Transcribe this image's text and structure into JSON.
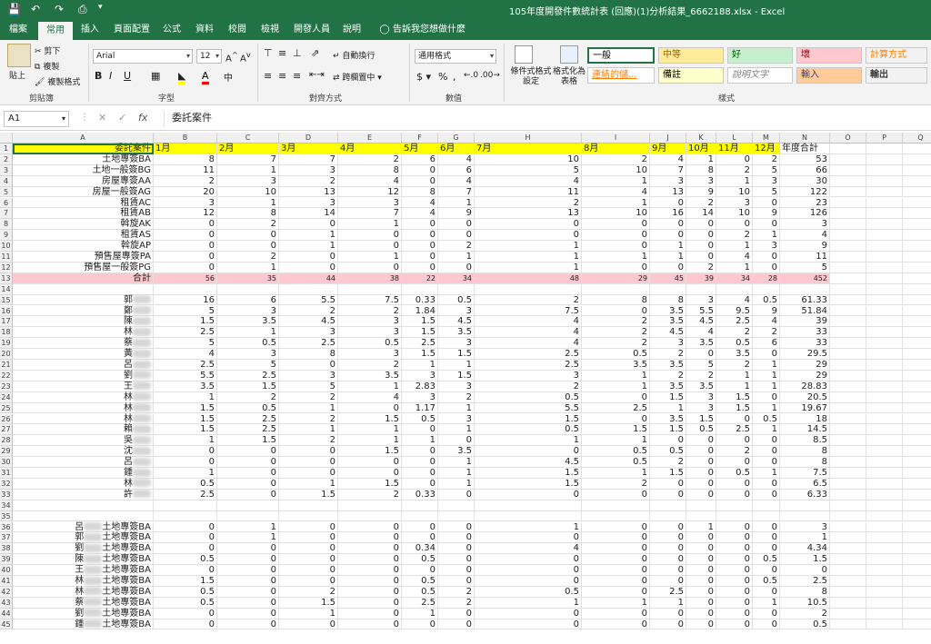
{
  "window": {
    "title": "105年度開發件數統計表 (回應)(1)分析結果_6662188.xlsx - Excel"
  },
  "tabs": [
    "檔案",
    "常用",
    "插入",
    "頁面配置",
    "公式",
    "資料",
    "校閱",
    "檢視",
    "開發人員",
    "說明"
  ],
  "tell_me": "告訴我您想做什麼",
  "ribbon": {
    "clipboard": {
      "paste": "貼上",
      "cut": "剪下",
      "copy": "複製",
      "format_painter": "複製格式",
      "label": "剪貼簿"
    },
    "font": {
      "name": "Arial",
      "size": "12",
      "label": "字型"
    },
    "alignment": {
      "wrap": "自動換行",
      "merge": "跨欄置中",
      "label": "對齊方式"
    },
    "number": {
      "format": "通用格式",
      "label": "數值"
    },
    "conditional": {
      "cf": "條件式格式設定",
      "table": "格式化為表格"
    },
    "styles": {
      "label": "樣式",
      "items": [
        {
          "text": "一般",
          "bg": "#ffffff",
          "fg": "#000000"
        },
        {
          "text": "中等",
          "bg": "#ffeb9c",
          "fg": "#9c6500"
        },
        {
          "text": "好",
          "bg": "#c6efce",
          "fg": "#006100"
        },
        {
          "text": "壞",
          "bg": "#ffc7ce",
          "fg": "#9c0006"
        },
        {
          "text": "計算方式",
          "bg": "#f2f2f2",
          "fg": "#fa7d00"
        },
        {
          "text": "連結的儲...",
          "bg": "#ffffff",
          "fg": "#fa7d00"
        },
        {
          "text": "備註",
          "bg": "#ffffcc",
          "fg": "#000000"
        },
        {
          "text": "說明文字",
          "bg": "#ffffff",
          "fg": "#7f7f7f"
        },
        {
          "text": "輸入",
          "bg": "#ffcc99",
          "fg": "#3f3f76"
        },
        {
          "text": "輸出",
          "bg": "#f2f2f2",
          "fg": "#3f3f3f"
        }
      ]
    }
  },
  "formula_bar": {
    "cell": "A1",
    "content": "委託案件"
  },
  "columns": [
    "A",
    "B",
    "C",
    "D",
    "E",
    "F",
    "G",
    "H",
    "I",
    "J",
    "K",
    "L",
    "M",
    "N",
    "O",
    "P",
    "Q"
  ],
  "header_row": [
    "委託案件",
    "1月",
    "2月",
    "3月",
    "4月",
    "5月",
    "6月",
    "7月",
    "8月",
    "9月",
    "10月",
    "11月",
    "12月",
    "年度合計"
  ],
  "rows": [
    {
      "r": 2,
      "a": "土地專簽BA",
      "v": [
        "8",
        "7",
        "7",
        "2",
        "6",
        "4",
        "10",
        "2",
        "4",
        "1",
        "0",
        "2",
        "53"
      ]
    },
    {
      "r": 3,
      "a": "土地一般簽BG",
      "v": [
        "11",
        "1",
        "3",
        "8",
        "0",
        "6",
        "5",
        "10",
        "7",
        "8",
        "2",
        "5",
        "66"
      ]
    },
    {
      "r": 4,
      "a": "房屋專簽AA",
      "v": [
        "2",
        "3",
        "2",
        "4",
        "0",
        "4",
        "4",
        "1",
        "3",
        "3",
        "1",
        "3",
        "30"
      ]
    },
    {
      "r": 5,
      "a": "房屋一般簽AG",
      "v": [
        "20",
        "10",
        "13",
        "12",
        "8",
        "7",
        "11",
        "4",
        "13",
        "9",
        "10",
        "5",
        "122"
      ]
    },
    {
      "r": 6,
      "a": "租賃AC",
      "v": [
        "3",
        "1",
        "3",
        "3",
        "4",
        "1",
        "2",
        "1",
        "0",
        "2",
        "3",
        "0",
        "23"
      ]
    },
    {
      "r": 7,
      "a": "租賃AB",
      "v": [
        "12",
        "8",
        "14",
        "7",
        "4",
        "9",
        "13",
        "10",
        "16",
        "14",
        "10",
        "9",
        "126"
      ]
    },
    {
      "r": 8,
      "a": "斡旋AK",
      "v": [
        "0",
        "2",
        "0",
        "1",
        "0",
        "0",
        "0",
        "0",
        "0",
        "0",
        "0",
        "0",
        "3"
      ]
    },
    {
      "r": 9,
      "a": "租賃AS",
      "v": [
        "0",
        "0",
        "1",
        "0",
        "0",
        "0",
        "0",
        "0",
        "0",
        "0",
        "2",
        "1",
        "4"
      ]
    },
    {
      "r": 10,
      "a": "斡旋AP",
      "v": [
        "0",
        "0",
        "1",
        "0",
        "0",
        "2",
        "1",
        "0",
        "1",
        "0",
        "1",
        "3",
        "9"
      ]
    },
    {
      "r": 11,
      "a": "預售屋專簽PA",
      "v": [
        "0",
        "2",
        "0",
        "1",
        "0",
        "1",
        "1",
        "1",
        "1",
        "0",
        "4",
        "0",
        "11"
      ]
    },
    {
      "r": 12,
      "a": "預售屋一般簽PG",
      "v": [
        "0",
        "1",
        "0",
        "0",
        "0",
        "0",
        "1",
        "0",
        "0",
        "2",
        "1",
        "0",
        "5"
      ]
    },
    {
      "r": 13,
      "a": "合計",
      "v": [
        "56",
        "35",
        "44",
        "38",
        "22",
        "34",
        "48",
        "29",
        "45",
        "39",
        "34",
        "28",
        "452"
      ],
      "pink": true
    },
    {
      "r": 14,
      "a": "",
      "v": []
    },
    {
      "r": 15,
      "a": "郭",
      "blur": true,
      "v": [
        "16",
        "6",
        "5.5",
        "7.5",
        "0.33",
        "0.5",
        "2",
        "8",
        "8",
        "3",
        "4",
        "0.5",
        "61.33"
      ]
    },
    {
      "r": 16,
      "a": "鄭",
      "blur": true,
      "v": [
        "5",
        "3",
        "2",
        "2",
        "1.84",
        "3",
        "7.5",
        "0",
        "3.5",
        "5.5",
        "9.5",
        "9",
        "51.84"
      ]
    },
    {
      "r": 17,
      "a": "陳",
      "blur": true,
      "v": [
        "1.5",
        "3.5",
        "4.5",
        "3",
        "1.5",
        "4.5",
        "4",
        "2",
        "3.5",
        "4.5",
        "2.5",
        "4",
        "39"
      ]
    },
    {
      "r": 18,
      "a": "林",
      "blur": true,
      "v": [
        "2.5",
        "1",
        "3",
        "3",
        "1.5",
        "3.5",
        "4",
        "2",
        "4.5",
        "4",
        "2",
        "2",
        "33"
      ]
    },
    {
      "r": 19,
      "a": "蔡",
      "blur": true,
      "v": [
        "5",
        "0.5",
        "2.5",
        "0.5",
        "2.5",
        "3",
        "4",
        "2",
        "3",
        "3.5",
        "0.5",
        "6",
        "33"
      ]
    },
    {
      "r": 20,
      "a": "黃",
      "blur": true,
      "v": [
        "4",
        "3",
        "8",
        "3",
        "1.5",
        "1.5",
        "2.5",
        "0.5",
        "2",
        "0",
        "3.5",
        "0",
        "29.5"
      ]
    },
    {
      "r": 21,
      "a": "呂",
      "blur": true,
      "v": [
        "2.5",
        "5",
        "0",
        "2",
        "1",
        "1",
        "2.5",
        "3.5",
        "3.5",
        "5",
        "2",
        "1",
        "29"
      ]
    },
    {
      "r": 22,
      "a": "劉",
      "blur": true,
      "v": [
        "5.5",
        "2.5",
        "3",
        "3.5",
        "3",
        "1.5",
        "3",
        "1",
        "2",
        "2",
        "1",
        "1",
        "29"
      ]
    },
    {
      "r": 23,
      "a": "王",
      "blur": true,
      "v": [
        "3.5",
        "1.5",
        "5",
        "1",
        "2.83",
        "3",
        "2",
        "1",
        "3.5",
        "3.5",
        "1",
        "1",
        "28.83"
      ]
    },
    {
      "r": 24,
      "a": "林",
      "blur": true,
      "v": [
        "1",
        "2",
        "2",
        "4",
        "3",
        "2",
        "0.5",
        "0",
        "1.5",
        "3",
        "1.5",
        "0",
        "20.5"
      ]
    },
    {
      "r": 25,
      "a": "林",
      "blur": true,
      "v": [
        "1.5",
        "0.5",
        "1",
        "0",
        "1.17",
        "1",
        "5.5",
        "2.5",
        "1",
        "3",
        "1.5",
        "1",
        "19.67"
      ]
    },
    {
      "r": 26,
      "a": "林",
      "blur": true,
      "v": [
        "1.5",
        "2.5",
        "2",
        "1.5",
        "0.5",
        "3",
        "1.5",
        "0",
        "3.5",
        "1.5",
        "0",
        "0.5",
        "18"
      ]
    },
    {
      "r": 27,
      "a": "賴",
      "blur": true,
      "v": [
        "1.5",
        "2.5",
        "1",
        "1",
        "0",
        "1",
        "0.5",
        "1.5",
        "1.5",
        "0.5",
        "2.5",
        "1",
        "14.5"
      ]
    },
    {
      "r": 28,
      "a": "吳",
      "blur": true,
      "v": [
        "1",
        "1.5",
        "2",
        "1",
        "1",
        "0",
        "1",
        "1",
        "0",
        "0",
        "0",
        "0",
        "8.5"
      ]
    },
    {
      "r": 29,
      "a": "沈",
      "blur": true,
      "v": [
        "0",
        "0",
        "0",
        "1.5",
        "0",
        "3.5",
        "0",
        "0.5",
        "0.5",
        "0",
        "2",
        "0",
        "8"
      ]
    },
    {
      "r": 30,
      "a": "呂",
      "blur": true,
      "v": [
        "0",
        "0",
        "0",
        "0",
        "0",
        "1",
        "4.5",
        "0.5",
        "2",
        "0",
        "0",
        "0",
        "8"
      ]
    },
    {
      "r": 31,
      "a": "鍾",
      "blur": true,
      "v": [
        "1",
        "0",
        "0",
        "0",
        "0",
        "1",
        "1.5",
        "1",
        "1.5",
        "0",
        "0.5",
        "1",
        "7.5"
      ]
    },
    {
      "r": 32,
      "a": "林",
      "blur": true,
      "v": [
        "0.5",
        "0",
        "1",
        "1.5",
        "0",
        "1",
        "1.5",
        "2",
        "0",
        "0",
        "0",
        "0",
        "6.5"
      ]
    },
    {
      "r": 33,
      "a": "許",
      "blur": true,
      "v": [
        "2.5",
        "0",
        "1.5",
        "2",
        "0.33",
        "0",
        "0",
        "0",
        "0",
        "0",
        "0",
        "0",
        "6.33"
      ]
    },
    {
      "r": 34,
      "a": "",
      "v": []
    },
    {
      "r": 35,
      "a": "",
      "v": []
    },
    {
      "r": 36,
      "a": "呂",
      "suffix": "土地專簽BA",
      "blur": true,
      "v": [
        "0",
        "1",
        "0",
        "0",
        "0",
        "0",
        "1",
        "0",
        "0",
        "1",
        "0",
        "0",
        "3"
      ]
    },
    {
      "r": 37,
      "a": "郭",
      "suffix": "土地專簽BA",
      "blur": true,
      "v": [
        "0",
        "1",
        "0",
        "0",
        "0",
        "0",
        "0",
        "0",
        "0",
        "0",
        "0",
        "0",
        "1"
      ]
    },
    {
      "r": 38,
      "a": "劉",
      "suffix": "土地專簽BA",
      "blur": true,
      "v": [
        "0",
        "0",
        "0",
        "0",
        "0.34",
        "0",
        "4",
        "0",
        "0",
        "0",
        "0",
        "0",
        "4.34"
      ]
    },
    {
      "r": 39,
      "a": "陳",
      "suffix": "土地專簽BA",
      "blur": true,
      "v": [
        "0.5",
        "0",
        "0",
        "0",
        "0.5",
        "0",
        "0",
        "0",
        "0",
        "0",
        "0",
        "0.5",
        "1.5"
      ]
    },
    {
      "r": 40,
      "a": "王",
      "suffix": "土地專簽BA",
      "blur": true,
      "v": [
        "0",
        "0",
        "0",
        "0",
        "0",
        "0",
        "0",
        "0",
        "0",
        "0",
        "0",
        "0",
        "0"
      ]
    },
    {
      "r": 41,
      "a": "林",
      "suffix": "土地專簽BA",
      "blur": true,
      "v": [
        "1.5",
        "0",
        "0",
        "0",
        "0.5",
        "0",
        "0",
        "0",
        "0",
        "0",
        "0",
        "0.5",
        "2.5"
      ]
    },
    {
      "r": 42,
      "a": "林",
      "suffix": "土地專簽BA",
      "blur": true,
      "v": [
        "0.5",
        "0",
        "2",
        "0",
        "0.5",
        "2",
        "0.5",
        "0",
        "2.5",
        "0",
        "0",
        "0",
        "8"
      ]
    },
    {
      "r": 43,
      "a": "蔡",
      "suffix": "土地專簽BA",
      "blur": true,
      "v": [
        "0.5",
        "0",
        "1.5",
        "0",
        "2.5",
        "2",
        "1",
        "1",
        "1",
        "0",
        "0",
        "1",
        "10.5"
      ]
    },
    {
      "r": 44,
      "a": "劉",
      "suffix": "土地專簽BA",
      "blur": true,
      "v": [
        "0",
        "0",
        "1",
        "0",
        "1",
        "0",
        "0",
        "0",
        "0",
        "0",
        "0",
        "0",
        "2"
      ]
    },
    {
      "r": 45,
      "a": "鍾",
      "suffix": "土地專簽BA",
      "blur": true,
      "v": [
        "0",
        "0",
        "0",
        "0",
        "0",
        "0",
        "0",
        "0",
        "0",
        "0",
        "0",
        "0",
        "0.5"
      ]
    }
  ]
}
